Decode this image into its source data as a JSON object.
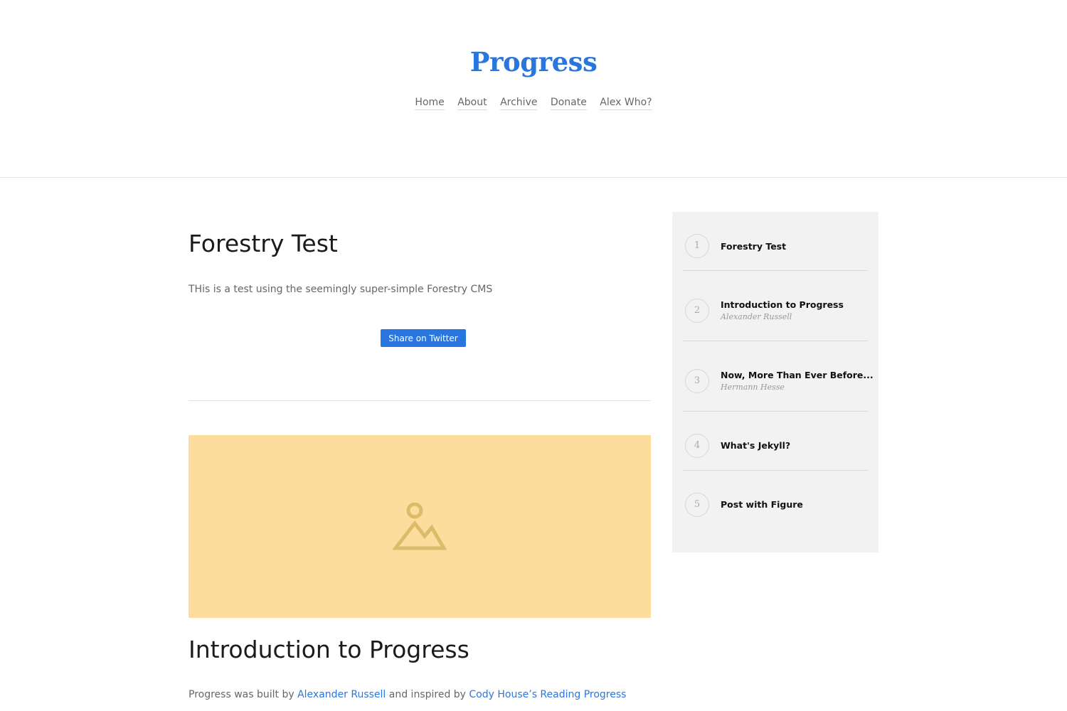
{
  "site": {
    "title": "Progress"
  },
  "nav": {
    "items": [
      {
        "label": "Home"
      },
      {
        "label": "About"
      },
      {
        "label": "Archive"
      },
      {
        "label": "Donate"
      },
      {
        "label": "Alex Who?"
      }
    ]
  },
  "posts": [
    {
      "title": "Forestry Test",
      "excerpt": "THis is a test using the seemingly super-simple Forestry CMS",
      "share_label": "Share on Twitter"
    },
    {
      "title": "Introduction to Progress",
      "image_icon": "image-placeholder-icon",
      "body": {
        "prefix": "Progress was built by ",
        "link1": "Alexander Russell",
        "middle": " and inspired by ",
        "link2": "Cody House’s Reading Progress"
      }
    }
  ],
  "sidebar": {
    "items": [
      {
        "num": "1",
        "title": "Forestry Test",
        "author": ""
      },
      {
        "num": "2",
        "title": "Introduction to Progress",
        "author": "Alexander Russell"
      },
      {
        "num": "3",
        "title": "Now, More Than Ever Before...",
        "author": "Hermann Hesse"
      },
      {
        "num": "4",
        "title": "What's Jekyll?",
        "author": ""
      },
      {
        "num": "5",
        "title": "Post with Figure",
        "author": ""
      }
    ]
  },
  "colors": {
    "accent": "#2a76df",
    "hero_bg": "#fcdd9b",
    "sidebar_bg": "#f2f2f2"
  }
}
